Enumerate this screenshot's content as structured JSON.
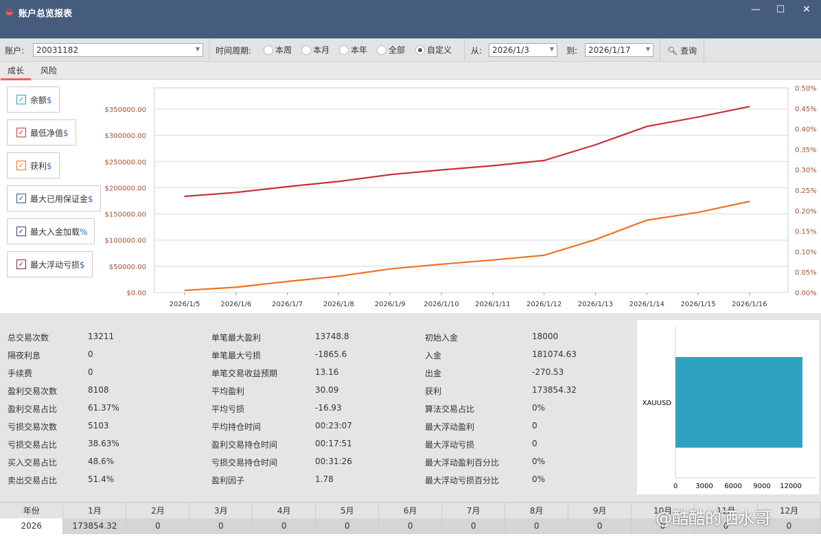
{
  "window": {
    "title": "账户总览报表",
    "min": "—",
    "max": "☐",
    "close": "✕"
  },
  "toolbar": {
    "account_label": "账户:",
    "account_value": "20031182",
    "period_label": "时间周期:",
    "periods": [
      {
        "label": "本周",
        "checked": false
      },
      {
        "label": "本月",
        "checked": false
      },
      {
        "label": "本年",
        "checked": false
      },
      {
        "label": "全部",
        "checked": false
      },
      {
        "label": "自定义",
        "checked": true
      }
    ],
    "from_label": "从:",
    "from_value": "2026/1/3",
    "to_label": "到:",
    "to_value": "2026/1/17",
    "query_label": "查询"
  },
  "tabs": [
    {
      "label": "成长",
      "active": true
    },
    {
      "label": "风险",
      "active": false
    }
  ],
  "legend": [
    {
      "label": "余额",
      "unit": "$",
      "color": "#2aa0b8",
      "checked": true
    },
    {
      "label": "最低净值",
      "unit": "$",
      "color": "#d0303a",
      "checked": true
    },
    {
      "label": "获利",
      "unit": "$",
      "color": "#f07020",
      "checked": true
    },
    {
      "label": "最大已用保证金",
      "unit": "$",
      "color": "#2a4f8f",
      "checked": true
    },
    {
      "label": "最大入金加载",
      "unit": "%",
      "color": "#3a3a6a",
      "checked": true
    },
    {
      "label": "最大浮动亏损",
      "unit": "$",
      "color": "#7a2a3a",
      "checked": true
    }
  ],
  "chart_data": {
    "type": "line",
    "x": [
      "2026/1/5",
      "2026/1/6",
      "2026/1/7",
      "2026/1/8",
      "2026/1/9",
      "2026/1/10",
      "2026/1/11",
      "2026/1/12",
      "2026/1/13",
      "2026/1/14",
      "2026/1/15",
      "2026/1/16"
    ],
    "y_ticks": [
      "$0.00",
      "$50000.00",
      "$100000.00",
      "$150000.00",
      "$200000.00",
      "$250000.00",
      "$300000.00",
      "$350000.00"
    ],
    "y2_ticks": [
      "0.00%",
      "0.05%",
      "0.10%",
      "0.15%",
      "0.20%",
      "0.25%",
      "0.30%",
      "0.35%",
      "0.40%",
      "0.45%",
      "0.50%"
    ],
    "ylim": [
      0,
      375000
    ],
    "y2lim": [
      0,
      0.5
    ],
    "series": [
      {
        "name": "最低净值",
        "color": "#c8303a",
        "values": [
          183500,
          191000,
          202000,
          212000,
          225000,
          234000,
          242000,
          252000,
          282000,
          317000,
          335000,
          355000
        ]
      },
      {
        "name": "获利",
        "color": "#f07020",
        "values": [
          4000,
          10000,
          21000,
          31000,
          45000,
          54000,
          62000,
          71000,
          101000,
          138000,
          153000,
          173854
        ]
      }
    ]
  },
  "stats": [
    [
      [
        "总交易次数",
        "13211"
      ],
      [
        "隔夜利息",
        "0"
      ],
      [
        "手续费",
        "0"
      ],
      [
        "盈利交易次数",
        "8108"
      ],
      [
        "盈利交易占比",
        "61.37%"
      ],
      [
        "亏损交易次数",
        "5103"
      ],
      [
        "亏损交易占比",
        "38.63%"
      ],
      [
        "买入交易占比",
        "48.6%"
      ],
      [
        "卖出交易占比",
        "51.4%"
      ]
    ],
    [
      [
        "单笔最大盈利",
        "13748.8"
      ],
      [
        "单笔最大亏损",
        "-1865.6"
      ],
      [
        "单笔交易收益预期",
        "13.16"
      ],
      [
        "平均盈利",
        "30.09"
      ],
      [
        "平均亏损",
        "-16.93"
      ],
      [
        "平均持仓时间",
        "00:23:07"
      ],
      [
        "盈利交易持仓时间",
        "00:17:51"
      ],
      [
        "亏损交易持仓时间",
        "00:31:26"
      ],
      [
        "盈利因子",
        "1.78"
      ]
    ],
    [
      [
        "初始入金",
        "18000"
      ],
      [
        "入金",
        "181074.63"
      ],
      [
        "出金",
        "-270.53"
      ],
      [
        "获利",
        "173854.32"
      ],
      [
        "算法交易占比",
        "0%"
      ],
      [
        "最大浮动盈利",
        "0"
      ],
      [
        "最大浮动亏损",
        "0"
      ],
      [
        "最大浮动盈利百分比",
        "0%"
      ],
      [
        "最大浮动亏损百分比",
        "0%"
      ]
    ]
  ],
  "bar_chart": {
    "type": "bar",
    "categories": [
      "XAUUSD"
    ],
    "values": [
      13211
    ],
    "x_ticks": [
      "0",
      "3000",
      "6000",
      "9000",
      "12000"
    ],
    "xlim": [
      0,
      14500
    ],
    "color": "#2ea3c1"
  },
  "monthly": {
    "headers": [
      "年份",
      "1月",
      "2月",
      "3月",
      "4月",
      "5月",
      "6月",
      "7月",
      "8月",
      "9月",
      "10月",
      "11月",
      "12月"
    ],
    "rows": [
      [
        "2026",
        "173854.32",
        "0",
        "0",
        "0",
        "0",
        "0",
        "0",
        "0",
        "0",
        "0",
        "0",
        "0"
      ]
    ]
  },
  "watermark": "@酷酷的洒水哥"
}
